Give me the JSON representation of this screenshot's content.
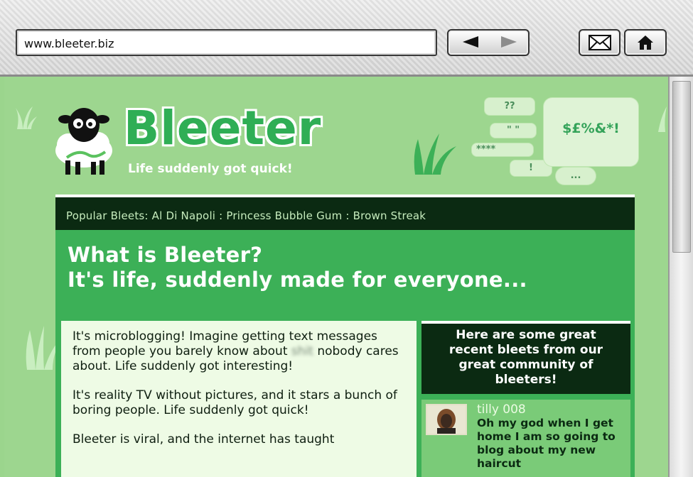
{
  "browser": {
    "url": "www.bleeter.biz",
    "back_icon": "back-arrow-icon",
    "forward_icon": "forward-arrow-icon",
    "mail_icon": "mail-icon",
    "home_icon": "home-icon"
  },
  "site": {
    "logo_text": "Bleeter",
    "tagline": "Life suddenly got quick!",
    "speech_bubbles": [
      "??",
      "\" \"",
      "****",
      "!",
      "...",
      "$£%&*!"
    ],
    "popular_bar": "Popular Bleets: Al Di Napoli : Princess Bubble Gum : Brown Streak"
  },
  "main": {
    "headline_line1": "What is Bleeter?",
    "headline_line2": "It's life, suddenly made for everyone...",
    "paragraph1_before": "It's microblogging! Imagine getting text messages from people you barely know about ",
    "paragraph1_blurred": "shit",
    "paragraph1_after": " nobody cares about. Life suddenly got interesting!",
    "paragraph2": "It's reality TV without pictures, and it stars a bunch of boring people. Life suddenly got quick!",
    "paragraph3": "Bleeter is viral, and the internet has taught"
  },
  "recent": {
    "heading": "Here are some great recent bleets from our great community of bleeters!",
    "bleet_user": "tilly 008",
    "bleet_text": "Oh my god when I get home I am so going to blog about my new haircut"
  },
  "colors": {
    "page_bg": "#9dd68f",
    "panel_green": "#3cb057",
    "dark_green": "#0b2a12",
    "logo_green": "#2fae55"
  }
}
